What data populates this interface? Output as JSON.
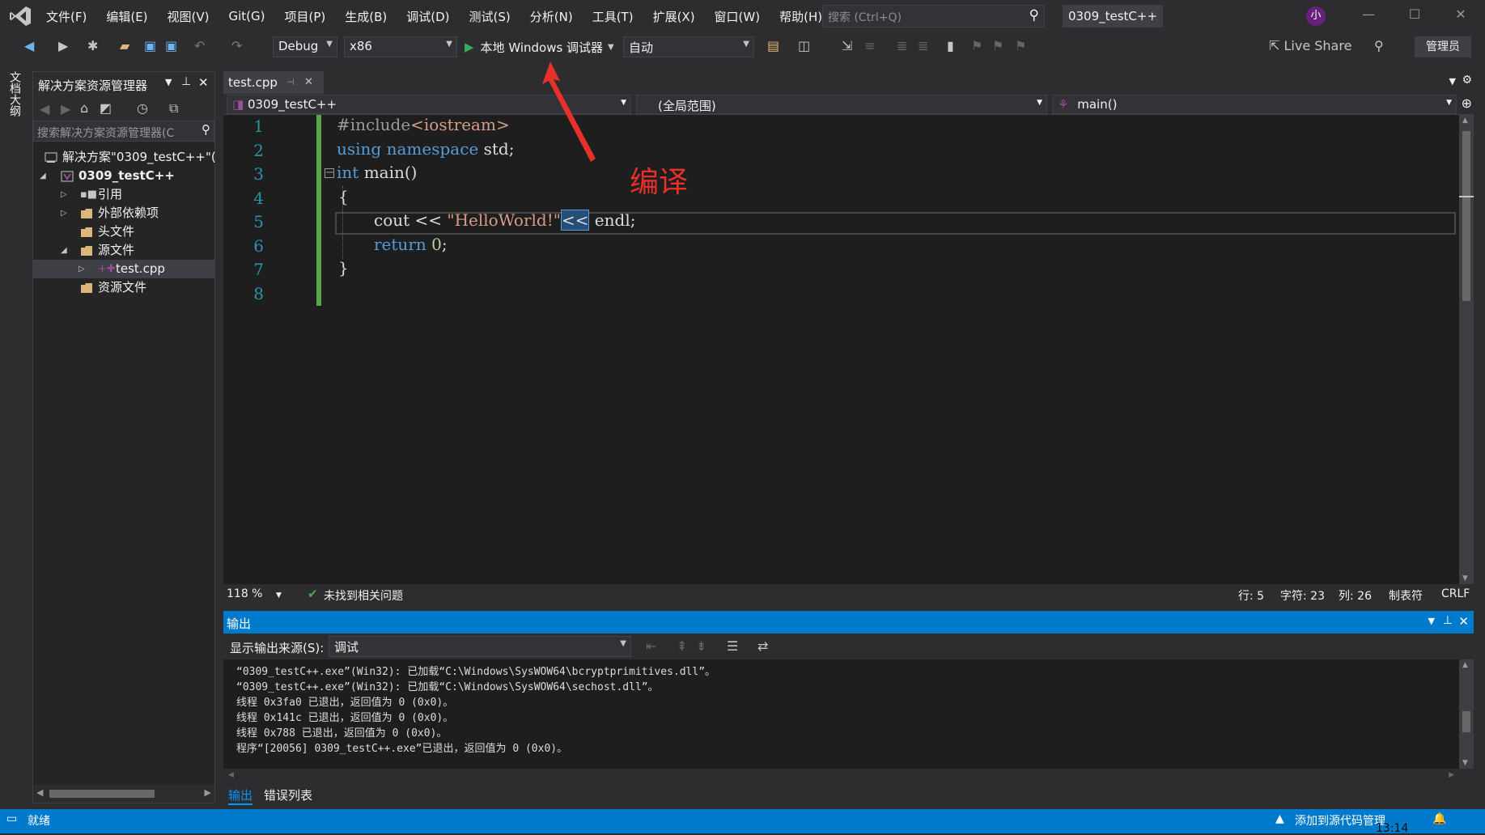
{
  "titlebar": {
    "menu": [
      "文件(F)",
      "编辑(E)",
      "视图(V)",
      "Git(G)",
      "项目(P)",
      "生成(B)",
      "调试(D)",
      "测试(S)",
      "分析(N)",
      "工具(T)",
      "扩展(X)",
      "窗口(W)",
      "帮助(H)"
    ],
    "search_placeholder": "搜索 (Ctrl+Q)",
    "solution_title": "0309_testC++",
    "avatar_initial": "小"
  },
  "toolbar": {
    "config": "Debug",
    "platform": "x86",
    "run_label": "本地 Windows 调试器",
    "run_mode": "自动",
    "live_share": "Live Share",
    "admin": "管理员"
  },
  "left_strip": {
    "doc_outline": "文档大纲"
  },
  "solution_explorer": {
    "title": "解决方案资源管理器",
    "search_placeholder": "搜索解决方案资源管理器(C",
    "items": [
      {
        "label": "解决方案\"0309_testC++\"(",
        "depth": 0,
        "expander": ""
      },
      {
        "label": "0309_testC++",
        "depth": 1,
        "expander": "expanded"
      },
      {
        "label": "引用",
        "depth": 2,
        "expander": "collapsed"
      },
      {
        "label": "外部依赖项",
        "depth": 2,
        "expander": "collapsed"
      },
      {
        "label": "头文件",
        "depth": 2,
        "expander": ""
      },
      {
        "label": "源文件",
        "depth": 2,
        "expander": "expanded"
      },
      {
        "label": "test.cpp",
        "depth": 3,
        "expander": "collapsed"
      },
      {
        "label": "资源文件",
        "depth": 2,
        "expander": ""
      }
    ]
  },
  "editor": {
    "tab_label": "test.cpp",
    "nav_project": "0309_testC++",
    "nav_scope": "(全局范围)",
    "nav_member": "main()",
    "line_numbers": [
      "1",
      "2",
      "3",
      "4",
      "5",
      "6",
      "7",
      "8"
    ],
    "code": {
      "l1_pp": "#include",
      "l1_inc": "<iostream>",
      "l2_kw1": "using",
      "l2_kw2": "namespace",
      "l2_rest": "std;",
      "l3_kw": "int",
      "l3_rest": "main()",
      "l4": "{",
      "l5_a": "cout << ",
      "l5_str": "\"HelloWorld!\"",
      "l5_op": "<<",
      "l5_b": " endl;",
      "l6_kw": "return",
      "l6_num": "0",
      "l6_end": ";",
      "l7": "}"
    },
    "status": {
      "zoom": "118 %",
      "issues": "未找到相关问题",
      "line": "行: 5",
      "char": "字符: 23",
      "col": "列: 26",
      "tabs": "制表符",
      "eol": "CRLF"
    }
  },
  "output": {
    "title": "输出",
    "source_label": "显示输出来源(S):",
    "source_value": "调试",
    "lines": [
      "“0309_testC++.exe”(Win32): 已加载“C:\\Windows\\SysWOW64\\bcryptprimitives.dll”。",
      "“0309_testC++.exe”(Win32): 已加载“C:\\Windows\\SysWOW64\\sechost.dll”。",
      "线程 0x3fa0 已退出，返回值为 0 (0x0)。",
      "线程 0x141c 已退出，返回值为 0 (0x0)。",
      "线程 0x788 已退出，返回值为 0 (0x0)。",
      "程序“[20056] 0309_testC++.exe”已退出，返回值为 0 (0x0)。"
    ],
    "tabs": [
      "输出",
      "错误列表"
    ]
  },
  "statusbar": {
    "ready": "就绪",
    "source_control": "添加到源代码管理",
    "time": "13:14"
  },
  "annotation": {
    "text": "编译",
    "color": "#e8302a"
  },
  "colors": {
    "accent": "#007acc",
    "editor_bg": "#1e1e1e",
    "chrome_bg": "#2d2d30"
  }
}
